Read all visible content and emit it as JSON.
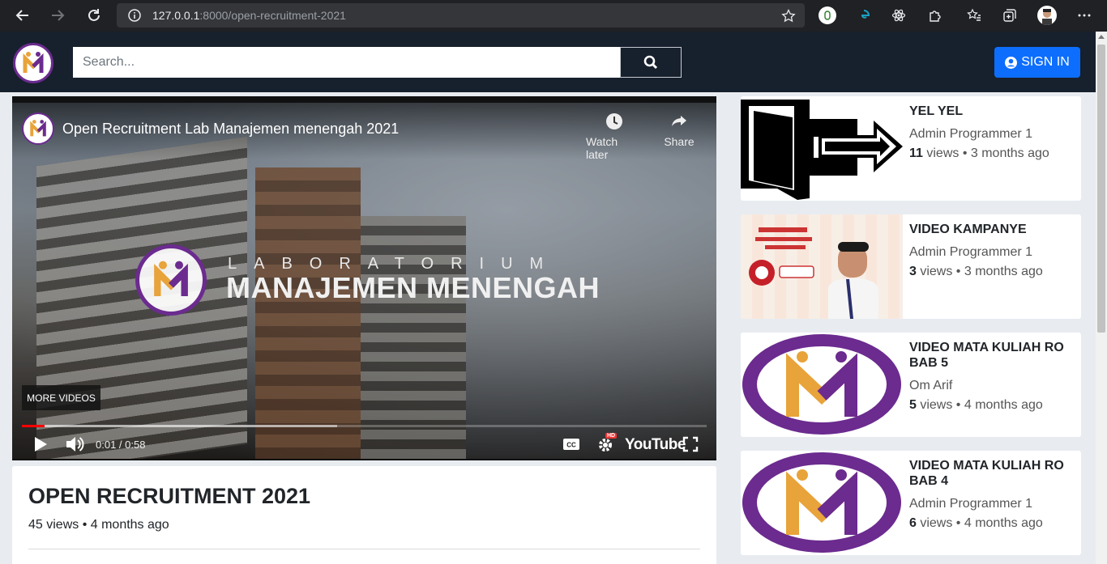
{
  "browser": {
    "url_host": "127.0.0.1",
    "url_path": ":8000/open-recruitment-2021"
  },
  "header": {
    "search_placeholder": "Search...",
    "signin_label": "SIGN IN"
  },
  "player": {
    "title": "Open Recruitment Lab Manajemen menengah 2021",
    "watch_later_label": "Watch later",
    "share_label": "Share",
    "overlay_top_text": "LABORATORIUM",
    "overlay_main_text": "MANAJEMEN MENENGAH",
    "more_videos_label": "MORE VIDEOS",
    "time_display": "0:01 / 0:58",
    "progress_played": 0.033,
    "progress_buffered": 0.46,
    "youtube_label": "YouTube",
    "hd_badge": "HD"
  },
  "video": {
    "title": "OPEN RECRUITMENT 2021",
    "meta": "45 views • 4 months ago"
  },
  "related": [
    {
      "title": "YEL YEL",
      "author": "Admin Programmer 1",
      "views": "11",
      "stats_suffix": " views • 3 months ago",
      "thumb": "exit-icon"
    },
    {
      "title": "VIDEO KAMPANYE",
      "author": "Admin Programmer 1",
      "views": "3",
      "stats_suffix": " views • 3 months ago",
      "thumb": "campaign-poster"
    },
    {
      "title": "VIDEO MATA KULIAH RO BAB 5",
      "author": "Om Arif",
      "views": "5",
      "stats_suffix": " views • 4 months ago",
      "thumb": "lab-emblem"
    },
    {
      "title": "VIDEO MATA KULIAH RO BAB 4",
      "author": "Admin Programmer 1",
      "views": "6",
      "stats_suffix": " views • 4 months ago",
      "thumb": "lab-emblem"
    }
  ],
  "colors": {
    "header_bg": "#17202d",
    "signin_bg": "#0d6efd",
    "page_bg": "#e8ecf1",
    "brand_purple": "#6b2b8f",
    "brand_orange": "#e8a33a",
    "progress_red": "#ff0000"
  }
}
